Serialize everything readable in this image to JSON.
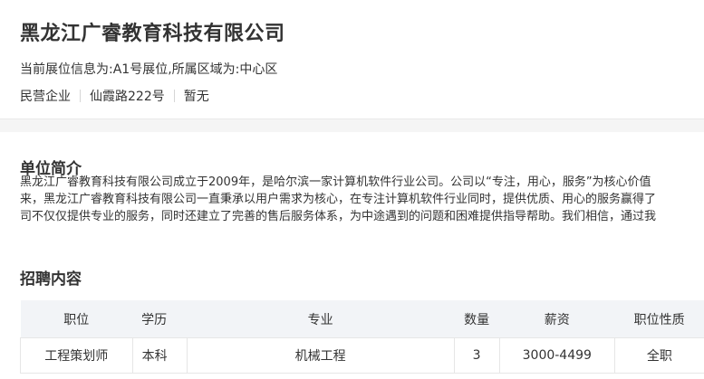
{
  "company": {
    "name": "黑龙江广睿教育科技有限公司",
    "booth_info": "当前展位信息为:A1号展位,所属区域为:中心区",
    "meta": [
      "民营企业",
      "仙霞路222号",
      "暂无"
    ]
  },
  "intro": {
    "title": "单位简介",
    "lines": [
      "黑龙江广睿教育科技有限公司成立于2009年，是哈尔滨一家计算机软件行业公司。公司以“专注，用心，服务”为核心价值",
      "来，黑龙江广睿教育科技有限公司一直秉承以用户需求为核心，在专注计算机软件行业同时，提供优质、用心的服务赢得了",
      "司不仅仅提供专业的服务，同时还建立了完善的售后服务体系，为中途遇到的问题和困难提供指导帮助。我们相信，通过我"
    ]
  },
  "recruit": {
    "title": "招聘内容",
    "columns": [
      "职位",
      "学历",
      "专业",
      "数量",
      "薪资",
      "职位性质"
    ],
    "rows": [
      [
        "工程策划师",
        "本科",
        "机械工程",
        "3",
        "3000-4499",
        "全职"
      ]
    ]
  }
}
